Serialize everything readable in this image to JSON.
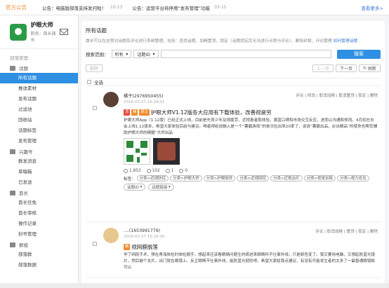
{
  "topbar": {
    "title": "官方公告",
    "notices": [
      {
        "text": "公告：电脑版部落支持发问啦！",
        "date": "10-13"
      },
      {
        "text": "公告：运营平台将停用“发布管理”功能",
        "date": "03-15"
      }
    ],
    "more": "查看更多>"
  },
  "profile": {
    "name": "护眼大师",
    "role": "职务：酋长酋长"
  },
  "sidebar": {
    "section": "部落管理",
    "groups": [
      {
        "label": "话题",
        "items": [
          "所有话题",
          "推送素材",
          "发布话题",
          "过滤池",
          "回收站",
          "话题标签",
          "发布管理"
        ]
      },
      {
        "label": "兴趣号",
        "items": [
          "群发消息",
          "草稿箱",
          "已发送"
        ]
      },
      {
        "label": "酋长",
        "items": [
          "酋长任免",
          "酋长审核",
          "操作记录",
          "封号管理"
        ]
      },
      {
        "label": "群组",
        "items": [
          "部落群",
          "部落数据"
        ]
      }
    ],
    "active_item": "所有话题"
  },
  "main": {
    "title": "所有话题",
    "desc": "酋长可以在这里对话题及评论进行系统管理，包括：查找话题、加精置顶、锁定（话题锁定后无法进行点赞与评论）、删除封禁、评论管理",
    "desc_link": "如何管理话题",
    "search": {
      "label": "搜索范围：",
      "scope": "所有",
      "field": "话题ID",
      "button": "搜索"
    },
    "toolbar": {
      "delete": "删除",
      "prev": "上一页",
      "next": "下一页",
      "refresh": "刷新"
    },
    "select_all": "全选"
  },
  "posts": [
    {
      "author": "橘子(2976950455)",
      "time": "2016-03-27 16:29:01",
      "actions": "评论 | 修改 | 取消加精 | 取消置顶 | 锁定 | 删除",
      "tags": [
        "顶",
        "精",
        "原文"
      ],
      "title": "护眼大师V1.12版各大应用有下载体验，改善视疲劳",
      "text": "护眼大师App（1.12版）已经正式上线，目前是先育少年及视疲劳、近视患者取体验，黄蓝口碑和市场交互反应，进而以沟通和修改。4月初左右会上线1.12版本，希望大家体验后给与建议。喝者得给说融入是一个“薯霸游戏”的单次拉出来20率了，该说“薯霸出品，必出精品”的使命也帮您辅助护眼大师的精髓“大师出品",
      "stats": {
        "views": "1,853",
        "likes": "102",
        "comments": "1",
        "shares": "0"
      },
      "label_prefix": "标签：",
      "labels": [
        "分类>近视防控",
        "分类>护眼大师",
        "分类>护眼软件",
        "分类>近视回控",
        "分类>近视治疗",
        "分类>视觉训练",
        "分类>视力优化"
      ],
      "dropdowns": [
        "话题ID",
        "话题链接"
      ]
    },
    {
      "author": "....(1653991779)",
      "time": "2016-03-27 15:16:26",
      "actions": "评论 | 取消加精 | 置顶 | 锁定 | 删除",
      "tags": [
        "精"
      ],
      "title": "视网膜脱落",
      "text": "学了网段手术，预在青海体检时体检顺手，想起来应该看眼睛问题生的病进来眼睛科不仕事外线，只是颜色变了。我又要用电脑，又想起防蓝光镜片，然后被个支片，出门就在眼镜上。反正眼睛不仕事外线，能防蓝光就防吧。希望大家给我点建议，有没有可能发生者的太多了一副普通眼镜既可以"
    }
  ]
}
